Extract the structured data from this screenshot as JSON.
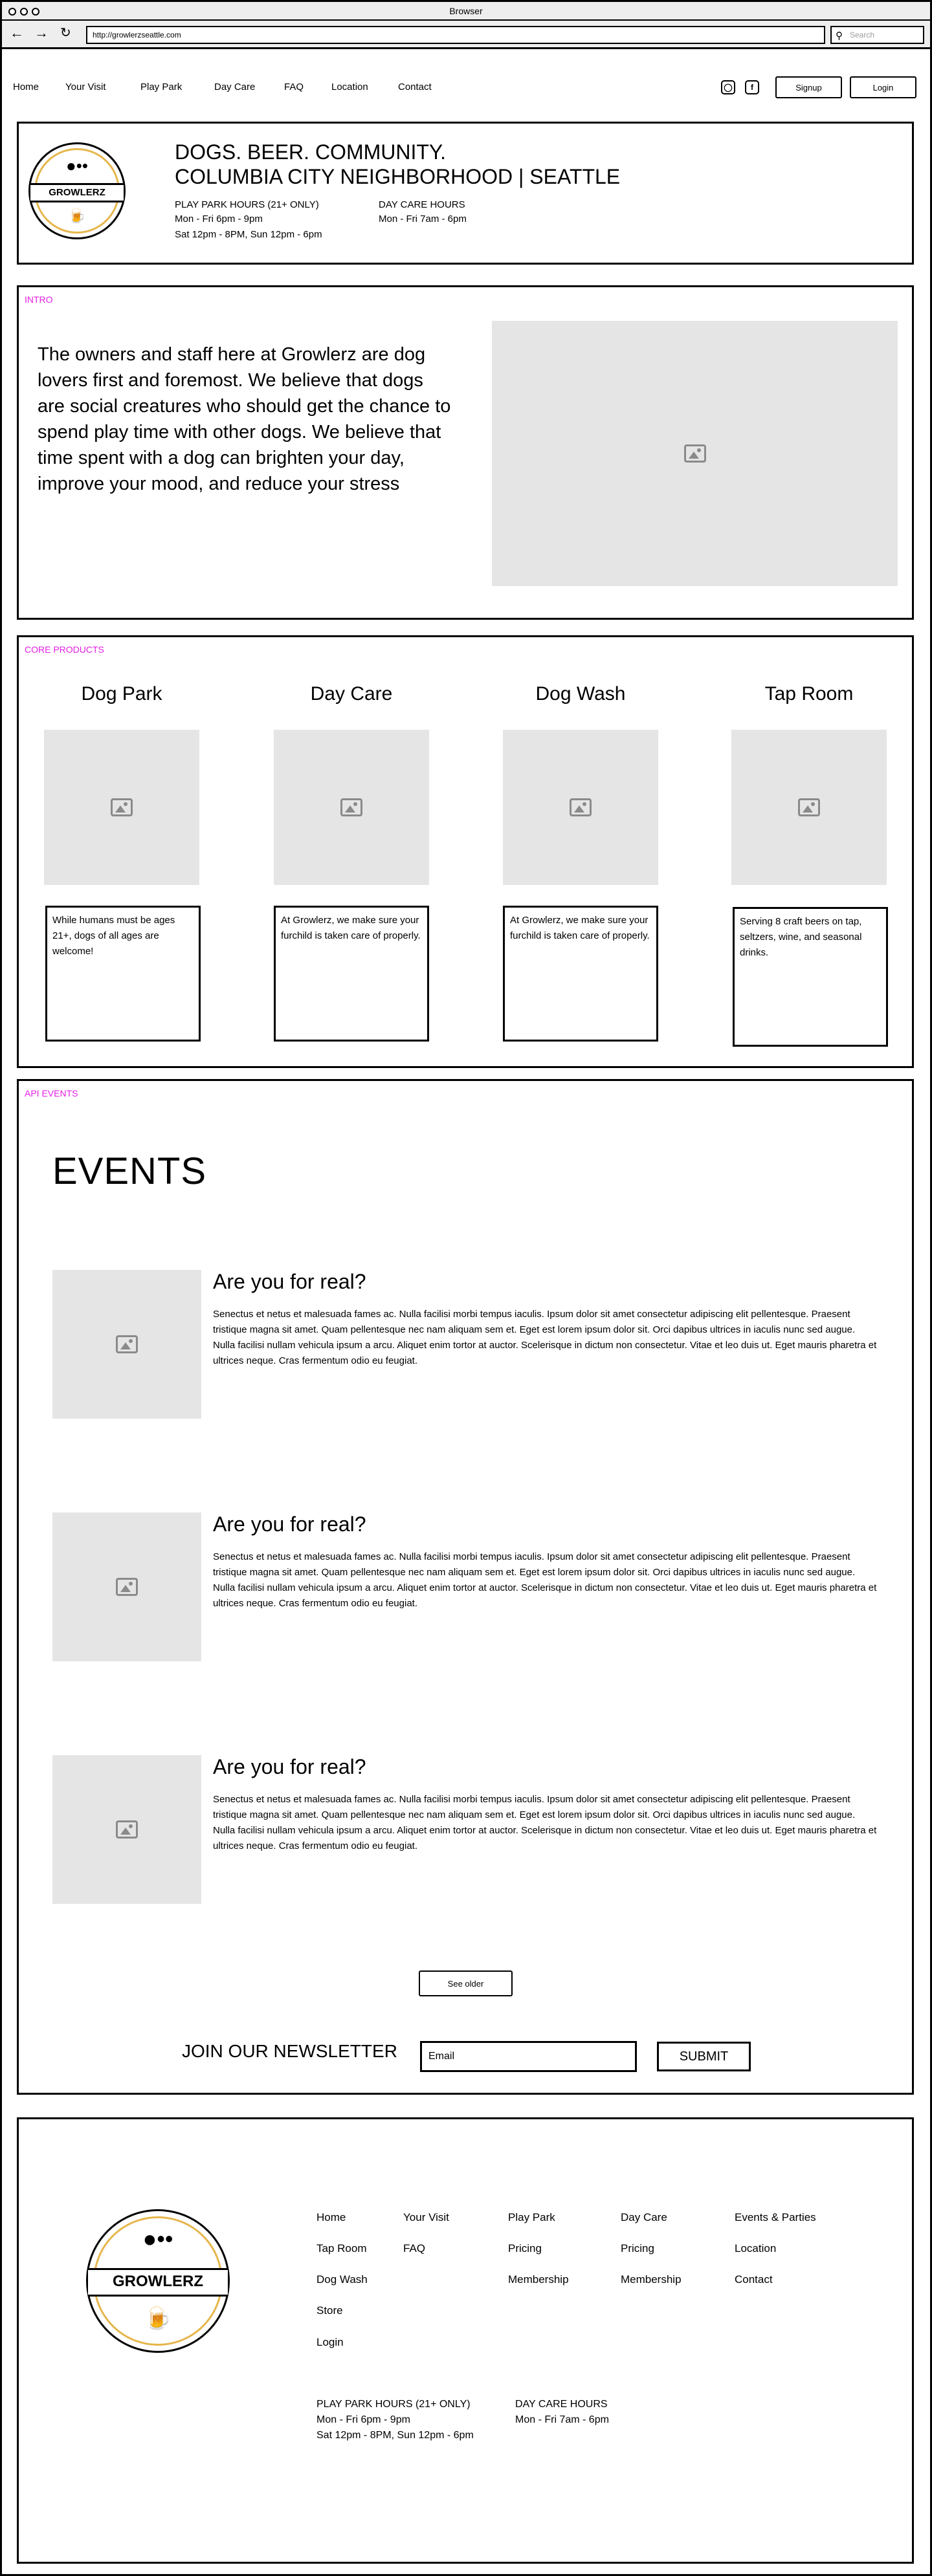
{
  "browser": {
    "title": "Browser",
    "url": "http://growlerzseattle.com",
    "search_placeholder": "Search"
  },
  "nav": {
    "links": [
      "Home",
      "Your Visit",
      "Play Park",
      "Day Care",
      "FAQ",
      "Location",
      "Contact"
    ],
    "signup": "Signup",
    "login": "Login"
  },
  "logo": {
    "name": "GROWLERZ"
  },
  "header": {
    "line1": "DOGS. BEER. COMMUNITY.",
    "line2": "COLUMBIA CITY NEIGHBORHOOD | SEATTLE",
    "play_title": "PLAY PARK HOURS (21+ ONLY)",
    "play_line1": "Mon - Fri 6pm - 9pm",
    "play_line2": "Sat 12pm - 8PM, Sun 12pm - 6pm",
    "care_title": "DAY CARE HOURS",
    "care_line1": "Mon - Fri 7am - 6pm"
  },
  "intro": {
    "label": "INTRO",
    "text": "The owners and staff here at Growlerz are dog lovers first and foremost.  We believe that dogs are social creatures who should get the chance to spend play time with other dogs. We believe that time spent with a dog can brighten your day, improve your mood, and reduce your stress"
  },
  "products": {
    "label": "CORE PRODUCTS",
    "items": [
      {
        "title": "Dog Park",
        "desc": "While humans must be ages 21+, dogs of all ages are welcome!"
      },
      {
        "title": "Day Care",
        "desc": "At Growlerz, we make sure your furchild is taken care of properly."
      },
      {
        "title": "Dog Wash",
        "desc": "At Growlerz, we make sure your furchild is taken care of properly."
      },
      {
        "title": "Tap Room",
        "desc": "Serving 8 craft beers on tap, seltzers, wine, and seasonal drinks."
      }
    ]
  },
  "events": {
    "label": "API EVENTS",
    "heading": "EVENTS",
    "items": [
      {
        "title": "Are you for real?",
        "body": "Senectus et netus et malesuada fames ac. Nulla facilisi morbi tempus iaculis. Ipsum dolor sit amet consectetur adipiscing elit pellentesque. Praesent tristique magna sit amet. Quam pellentesque nec nam aliquam sem et. Eget est lorem ipsum dolor sit. Orci dapibus ultrices in iaculis nunc sed augue. Nulla facilisi nullam vehicula ipsum a arcu. Aliquet enim tortor at auctor. Scelerisque in dictum non consectetur. Vitae et leo duis ut. Eget mauris pharetra et ultrices neque. Cras fermentum odio eu feugiat."
      },
      {
        "title": "Are you for real?",
        "body": "Senectus et netus et malesuada fames ac. Nulla facilisi morbi tempus iaculis. Ipsum dolor sit amet consectetur adipiscing elit pellentesque. Praesent tristique magna sit amet. Quam pellentesque nec nam aliquam sem et. Eget est lorem ipsum dolor sit. Orci dapibus ultrices in iaculis nunc sed augue. Nulla facilisi nullam vehicula ipsum a arcu. Aliquet enim tortor at auctor. Scelerisque in dictum non consectetur. Vitae et leo duis ut. Eget mauris pharetra et ultrices neque. Cras fermentum odio eu feugiat."
      },
      {
        "title": "Are you for real?",
        "body": "Senectus et netus et malesuada fames ac. Nulla facilisi morbi tempus iaculis. Ipsum dolor sit amet consectetur adipiscing elit pellentesque. Praesent tristique magna sit amet. Quam pellentesque nec nam aliquam sem et. Eget est lorem ipsum dolor sit. Orci dapibus ultrices in iaculis nunc sed augue. Nulla facilisi nullam vehicula ipsum a arcu. Aliquet enim tortor at auctor. Scelerisque in dictum non consectetur. Vitae et leo duis ut. Eget mauris pharetra et ultrices neque. Cras fermentum odio eu feugiat."
      }
    ],
    "see_older": "See older"
  },
  "newsletter": {
    "label": "JOIN OUR NEWSLETTER",
    "email_value": "Email",
    "submit": "SUBMIT"
  },
  "footer": {
    "col1": [
      "Home",
      "Tap Room",
      "Dog Wash",
      "Store",
      "Login"
    ],
    "col2": [
      "Your Visit",
      "FAQ"
    ],
    "col3": [
      "Play Park",
      "Pricing",
      "Membership"
    ],
    "col4": [
      "Day Care",
      "Pricing",
      "Membership"
    ],
    "col5": [
      "Events & Parties",
      "Location",
      "Contact"
    ],
    "play_title": "PLAY PARK HOURS (21+ ONLY)",
    "play_line1": "Mon - Fri 6pm - 9pm",
    "play_line2": "Sat 12pm - 8PM, Sun 12pm - 6pm",
    "care_title": "DAY CARE HOURS",
    "care_line1": "Mon - Fri 7am - 6pm"
  },
  "colors": {
    "section_label": "#e41ee4",
    "placeholder": "#e5e5e5",
    "logo_ring": "#e6b64c",
    "chrome": "#eeeeee"
  },
  "icons": [
    "back-arrow-icon",
    "forward-arrow-icon",
    "refresh-icon",
    "search-icon",
    "instagram-icon",
    "facebook-icon",
    "image-placeholder-icon",
    "paw-icon",
    "beer-mug-icon"
  ]
}
